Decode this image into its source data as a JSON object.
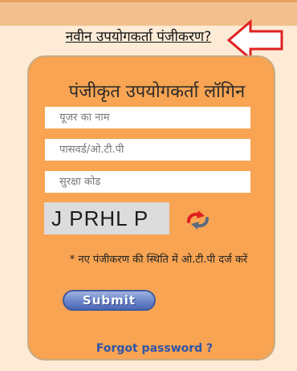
{
  "header": {
    "register_link": "नवीन उपयोगकर्ता पंजीकरण?"
  },
  "login": {
    "title": "पंजीकृत उपयोगकर्ता लॉगिन",
    "username_placeholder": "यूजर का नाम",
    "password_placeholder": "पासवर्ड/ओ.टी.पी",
    "security_code_placeholder": "सुरक्षा कोड",
    "captcha_text": "J PRHL P",
    "note": "* नए पंजीकरण की स्थिति में ओ.टी.पी दर्ज करें",
    "submit_label": "Submit",
    "forgot_password": "Forgot password ?"
  },
  "colors": {
    "page_background": "#fdebd6",
    "card_background": "#f8a452",
    "arrow": "#e02020",
    "link_blue": "#2f54a8"
  },
  "icons": {
    "arrow": "left-arrow-icon",
    "refresh": "refresh-icon"
  }
}
